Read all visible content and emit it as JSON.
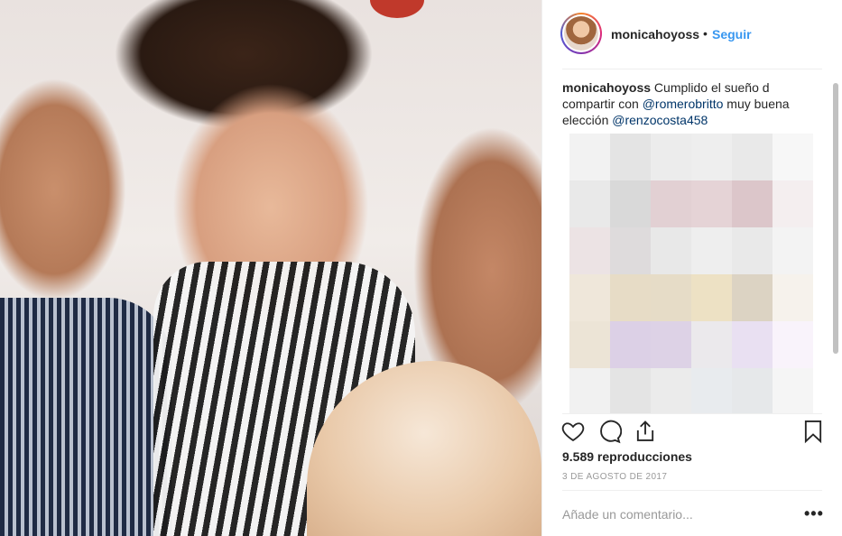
{
  "post": {
    "username": "monicahoyoss",
    "separator": "•",
    "follow_label": "Seguir",
    "caption": {
      "user": "monicahoyoss",
      "text_1": " Cumplido el sueño d compartir con ",
      "mention_1": "@romerobritto",
      "text_2": " muy buena elección ",
      "mention_2": "@renzocosta458"
    },
    "views": "9.589 reproducciones",
    "date": "3 DE AGOSTO DE 2017",
    "comment_placeholder": "Añade un comentario...",
    "more_label": "•••"
  },
  "icons": {
    "like": "heart-icon",
    "comment": "comment-icon",
    "share": "share-icon",
    "save": "bookmark-icon",
    "more": "more-options-icon"
  },
  "colors": {
    "link": "#3897f0",
    "mention": "#003569",
    "text": "#262626",
    "muted": "#999999",
    "divider": "#efefef"
  }
}
